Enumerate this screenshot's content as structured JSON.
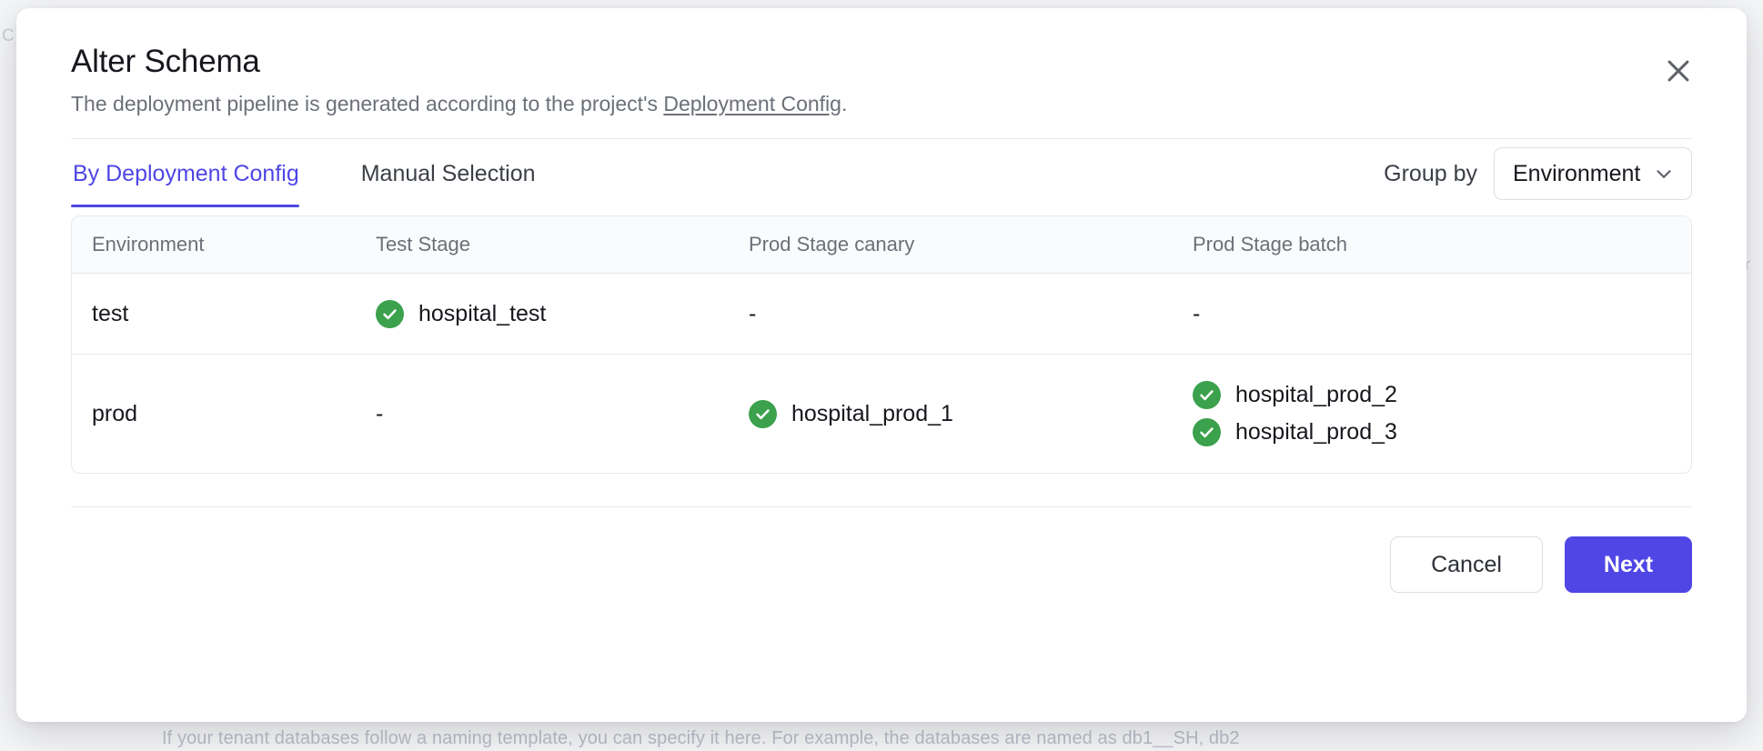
{
  "backdrop": {
    "left_glyph": "C",
    "right_glyph": "r",
    "bottom_text": "If your tenant databases follow a naming template, you can specify it here. For example, the databases are named as db1__SH, db2"
  },
  "dialog": {
    "title": "Alter Schema",
    "subtitle_before": "The deployment pipeline is generated according to the project's ",
    "subtitle_link": "Deployment Config",
    "subtitle_after": ".",
    "close_icon": "close-icon"
  },
  "tabs": [
    {
      "label": "By Deployment Config",
      "active": true
    },
    {
      "label": "Manual Selection",
      "active": false
    }
  ],
  "group_by": {
    "label": "Group by",
    "value": "Environment",
    "chevron_icon": "chevron-down-icon"
  },
  "table": {
    "columns": [
      "Environment",
      "Test Stage",
      "Prod Stage canary",
      "Prod Stage batch"
    ],
    "rows": [
      {
        "environment": "test",
        "test_stage": [
          {
            "label": "hospital_test",
            "status": "checked"
          }
        ],
        "prod_stage_canary": [
          {
            "label": "-",
            "status": "none"
          }
        ],
        "prod_stage_batch": [
          {
            "label": "-",
            "status": "none"
          }
        ]
      },
      {
        "environment": "prod",
        "test_stage": [
          {
            "label": "-",
            "status": "none"
          }
        ],
        "prod_stage_canary": [
          {
            "label": "hospital_prod_1",
            "status": "checked"
          }
        ],
        "prod_stage_batch": [
          {
            "label": "hospital_prod_2",
            "status": "checked"
          },
          {
            "label": "hospital_prod_3",
            "status": "checked"
          }
        ]
      }
    ]
  },
  "footer": {
    "cancel_label": "Cancel",
    "next_label": "Next"
  },
  "colors": {
    "accent": "#4F46E5",
    "success": "#3BA14C",
    "text_primary": "#16181D",
    "text_muted": "#6B7078",
    "border": "#E7E8EC"
  }
}
